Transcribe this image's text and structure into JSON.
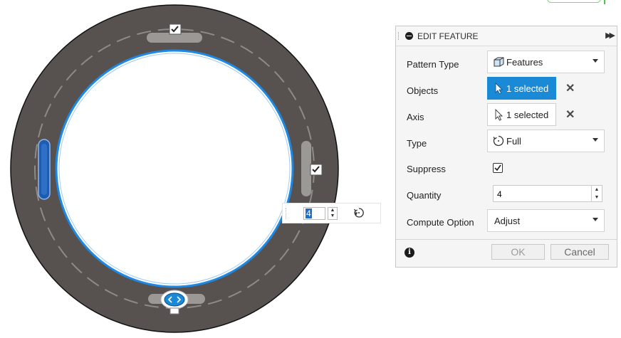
{
  "colors": {
    "ring_fill": "#57524f",
    "ring_outline": "#111111",
    "hole_edge": "#1e88e5",
    "accent": "#1a8ad6"
  },
  "viewport": {
    "manipulators": [
      {
        "name": "top-feature-handle",
        "icon": "checkbox-icon"
      },
      {
        "name": "right-feature-handle",
        "icon": "checkbox-icon"
      },
      {
        "name": "left-feature-handle",
        "icon": "selected-feature"
      },
      {
        "name": "bottom-feature-handle",
        "icon": "chevron-left-right-icon"
      }
    ],
    "mini_toolbar": {
      "quantity_value": "4",
      "type_icon": "full-circle-pattern-icon"
    }
  },
  "dialog": {
    "title": "EDIT FEATURE",
    "expand_icon": "double-chevron-right-icon",
    "rows": {
      "pattern_type": {
        "label": "Pattern Type",
        "value": "Features",
        "icon": "feature-cube-icon"
      },
      "objects": {
        "label": "Objects",
        "value": "1 selected",
        "icon": "cursor-arrow-icon"
      },
      "axis": {
        "label": "Axis",
        "value": "1 selected",
        "icon": "cursor-arrow-icon"
      },
      "type": {
        "label": "Type",
        "value": "Full",
        "icon": "full-circle-pattern-icon"
      },
      "suppress": {
        "label": "Suppress",
        "checked": true
      },
      "quantity": {
        "label": "Quantity",
        "value": "4"
      },
      "compute_option": {
        "label": "Compute Option",
        "value": "Adjust"
      }
    },
    "footer": {
      "info_icon": "i",
      "ok_label": "OK",
      "cancel_label": "Cancel"
    }
  }
}
